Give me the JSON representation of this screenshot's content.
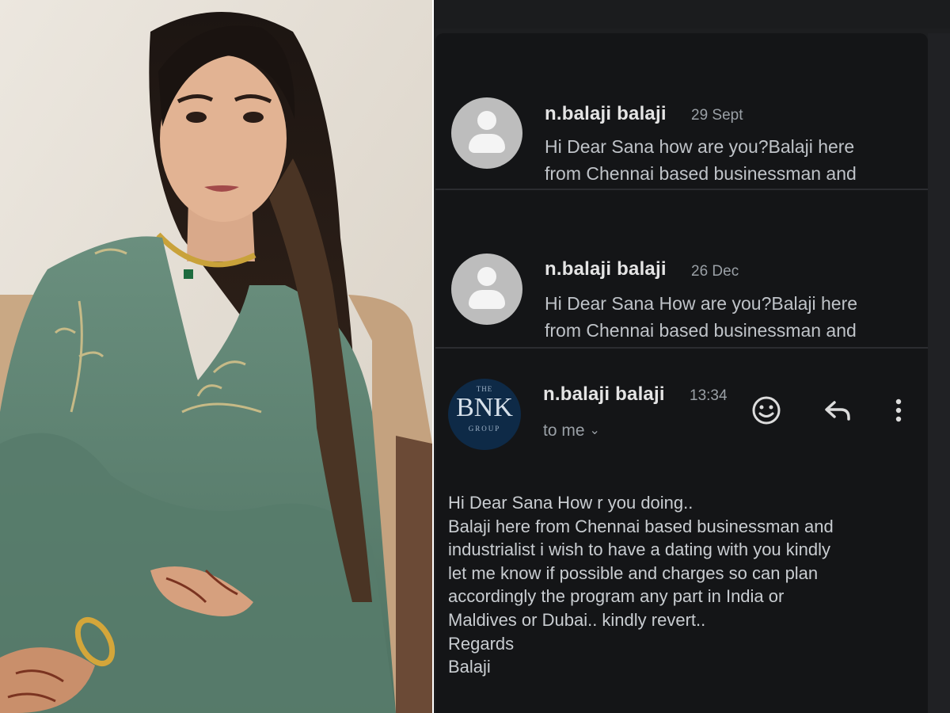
{
  "emails": [
    {
      "sender": "n.balaji balaji",
      "date": "29 Sept",
      "snippet_lines": [
        "Hi Dear Sana how are you?Balaji here",
        "from Chennai based businessman and"
      ]
    },
    {
      "sender": "n.balaji balaji",
      "date": "26 Dec",
      "snippet_lines": [
        "Hi Dear Sana How are you?Balaji here",
        "from Chennai based businessman and"
      ]
    }
  ],
  "open_email": {
    "sender": "n.balaji balaji",
    "time": "13:34",
    "recipient_label": "to me",
    "avatar_logo": {
      "top": "THE",
      "main": "BNK",
      "bottom": "GROUP"
    },
    "body_lines": [
      "Hi Dear Sana How r you doing..",
      "Balaji here from Chennai based businessman and",
      "industrialist i wish to have a dating with you kindly",
      "let me know if possible and charges so can plan",
      "accordingly the program any part in India or",
      "Maldives or Dubai.. kindly revert..",
      "Regards",
      "Balaji"
    ]
  },
  "icons": {
    "emoji": "smile-icon",
    "reply": "reply-icon",
    "more": "more-vertical-icon",
    "avatar": "person-icon"
  },
  "colors": {
    "background": "#141517",
    "sender_text": "#e4e4e4",
    "snippet_text": "#bfc3c8",
    "secondary_text": "#9aa0a6",
    "avatar_bg": "#bdbdbd",
    "logo_bg": "#0e2a47",
    "dress": "#5f8574"
  }
}
